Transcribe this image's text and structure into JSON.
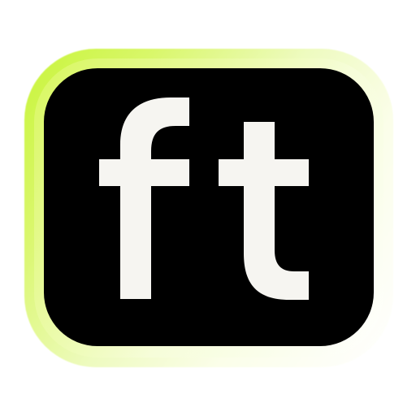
{
  "logo": {
    "lettering": "ft",
    "colors": {
      "tile": "#000000",
      "letters": "#f6f5f1",
      "glow_accent": "#c8f53a",
      "glow_fade": "#ffffff"
    },
    "icon_name": "ft-app-icon"
  }
}
